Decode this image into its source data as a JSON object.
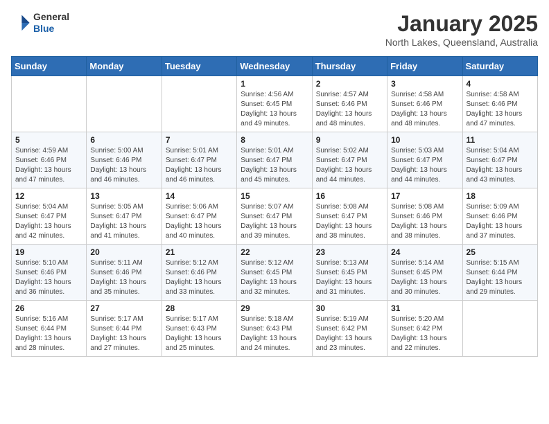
{
  "header": {
    "logo_general": "General",
    "logo_blue": "Blue",
    "month_title": "January 2025",
    "location": "North Lakes, Queensland, Australia"
  },
  "days_of_week": [
    "Sunday",
    "Monday",
    "Tuesday",
    "Wednesday",
    "Thursday",
    "Friday",
    "Saturday"
  ],
  "weeks": [
    [
      {
        "day": "",
        "info": ""
      },
      {
        "day": "",
        "info": ""
      },
      {
        "day": "",
        "info": ""
      },
      {
        "day": "1",
        "info": "Sunrise: 4:56 AM\nSunset: 6:45 PM\nDaylight: 13 hours\nand 49 minutes."
      },
      {
        "day": "2",
        "info": "Sunrise: 4:57 AM\nSunset: 6:46 PM\nDaylight: 13 hours\nand 48 minutes."
      },
      {
        "day": "3",
        "info": "Sunrise: 4:58 AM\nSunset: 6:46 PM\nDaylight: 13 hours\nand 48 minutes."
      },
      {
        "day": "4",
        "info": "Sunrise: 4:58 AM\nSunset: 6:46 PM\nDaylight: 13 hours\nand 47 minutes."
      }
    ],
    [
      {
        "day": "5",
        "info": "Sunrise: 4:59 AM\nSunset: 6:46 PM\nDaylight: 13 hours\nand 47 minutes."
      },
      {
        "day": "6",
        "info": "Sunrise: 5:00 AM\nSunset: 6:46 PM\nDaylight: 13 hours\nand 46 minutes."
      },
      {
        "day": "7",
        "info": "Sunrise: 5:01 AM\nSunset: 6:47 PM\nDaylight: 13 hours\nand 46 minutes."
      },
      {
        "day": "8",
        "info": "Sunrise: 5:01 AM\nSunset: 6:47 PM\nDaylight: 13 hours\nand 45 minutes."
      },
      {
        "day": "9",
        "info": "Sunrise: 5:02 AM\nSunset: 6:47 PM\nDaylight: 13 hours\nand 44 minutes."
      },
      {
        "day": "10",
        "info": "Sunrise: 5:03 AM\nSunset: 6:47 PM\nDaylight: 13 hours\nand 44 minutes."
      },
      {
        "day": "11",
        "info": "Sunrise: 5:04 AM\nSunset: 6:47 PM\nDaylight: 13 hours\nand 43 minutes."
      }
    ],
    [
      {
        "day": "12",
        "info": "Sunrise: 5:04 AM\nSunset: 6:47 PM\nDaylight: 13 hours\nand 42 minutes."
      },
      {
        "day": "13",
        "info": "Sunrise: 5:05 AM\nSunset: 6:47 PM\nDaylight: 13 hours\nand 41 minutes."
      },
      {
        "day": "14",
        "info": "Sunrise: 5:06 AM\nSunset: 6:47 PM\nDaylight: 13 hours\nand 40 minutes."
      },
      {
        "day": "15",
        "info": "Sunrise: 5:07 AM\nSunset: 6:47 PM\nDaylight: 13 hours\nand 39 minutes."
      },
      {
        "day": "16",
        "info": "Sunrise: 5:08 AM\nSunset: 6:47 PM\nDaylight: 13 hours\nand 38 minutes."
      },
      {
        "day": "17",
        "info": "Sunrise: 5:08 AM\nSunset: 6:46 PM\nDaylight: 13 hours\nand 38 minutes."
      },
      {
        "day": "18",
        "info": "Sunrise: 5:09 AM\nSunset: 6:46 PM\nDaylight: 13 hours\nand 37 minutes."
      }
    ],
    [
      {
        "day": "19",
        "info": "Sunrise: 5:10 AM\nSunset: 6:46 PM\nDaylight: 13 hours\nand 36 minutes."
      },
      {
        "day": "20",
        "info": "Sunrise: 5:11 AM\nSunset: 6:46 PM\nDaylight: 13 hours\nand 35 minutes."
      },
      {
        "day": "21",
        "info": "Sunrise: 5:12 AM\nSunset: 6:46 PM\nDaylight: 13 hours\nand 33 minutes."
      },
      {
        "day": "22",
        "info": "Sunrise: 5:12 AM\nSunset: 6:45 PM\nDaylight: 13 hours\nand 32 minutes."
      },
      {
        "day": "23",
        "info": "Sunrise: 5:13 AM\nSunset: 6:45 PM\nDaylight: 13 hours\nand 31 minutes."
      },
      {
        "day": "24",
        "info": "Sunrise: 5:14 AM\nSunset: 6:45 PM\nDaylight: 13 hours\nand 30 minutes."
      },
      {
        "day": "25",
        "info": "Sunrise: 5:15 AM\nSunset: 6:44 PM\nDaylight: 13 hours\nand 29 minutes."
      }
    ],
    [
      {
        "day": "26",
        "info": "Sunrise: 5:16 AM\nSunset: 6:44 PM\nDaylight: 13 hours\nand 28 minutes."
      },
      {
        "day": "27",
        "info": "Sunrise: 5:17 AM\nSunset: 6:44 PM\nDaylight: 13 hours\nand 27 minutes."
      },
      {
        "day": "28",
        "info": "Sunrise: 5:17 AM\nSunset: 6:43 PM\nDaylight: 13 hours\nand 25 minutes."
      },
      {
        "day": "29",
        "info": "Sunrise: 5:18 AM\nSunset: 6:43 PM\nDaylight: 13 hours\nand 24 minutes."
      },
      {
        "day": "30",
        "info": "Sunrise: 5:19 AM\nSunset: 6:42 PM\nDaylight: 13 hours\nand 23 minutes."
      },
      {
        "day": "31",
        "info": "Sunrise: 5:20 AM\nSunset: 6:42 PM\nDaylight: 13 hours\nand 22 minutes."
      },
      {
        "day": "",
        "info": ""
      }
    ]
  ]
}
